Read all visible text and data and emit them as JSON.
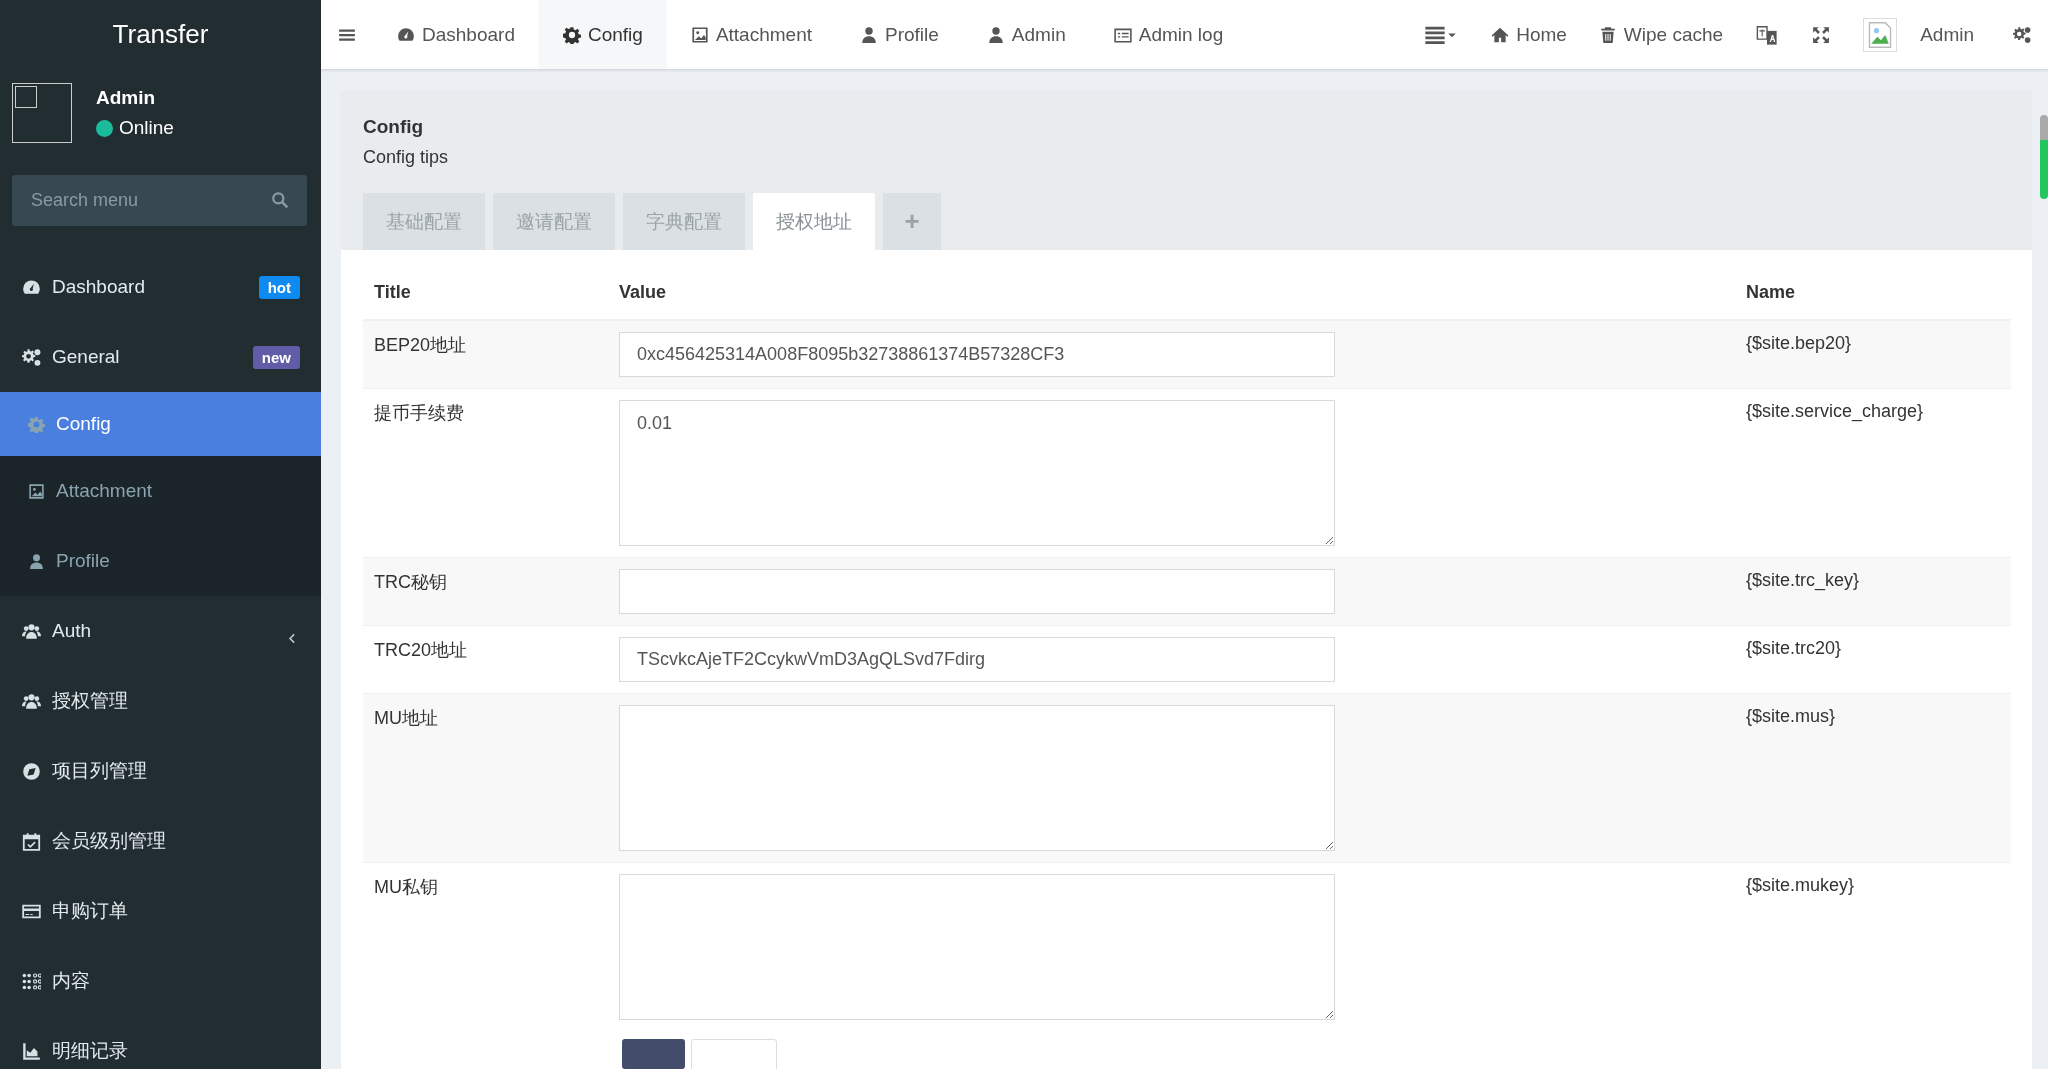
{
  "sidebar": {
    "title": "Transfer",
    "user": {
      "name": "Admin",
      "status": "Online"
    },
    "search": {
      "placeholder": "Search menu"
    },
    "items": [
      {
        "label": "Dashboard",
        "badge": "hot",
        "color": "#0f8af0",
        "selected": false
      },
      {
        "label": "General",
        "badge": "new",
        "color": "#605ca8",
        "selected": false,
        "expanded": true,
        "children": [
          {
            "label": "Config",
            "selected": true
          },
          {
            "label": "Attachment",
            "selected": false
          },
          {
            "label": "Profile",
            "selected": false
          }
        ]
      },
      {
        "label": "Auth",
        "selected": false,
        "expanded": false
      },
      {
        "label": "授权管理",
        "selected": false
      },
      {
        "label": "项目列管理",
        "selected": false
      },
      {
        "label": "会员级别管理",
        "selected": false
      },
      {
        "label": "申购订单",
        "selected": false
      },
      {
        "label": "内容",
        "selected": false
      },
      {
        "label": "明细记录",
        "selected": false
      }
    ]
  },
  "navbar": {
    "tabs": [
      {
        "label": "Dashboard",
        "selected": false
      },
      {
        "label": "Config",
        "selected": true
      },
      {
        "label": "Attachment",
        "selected": false
      },
      {
        "label": "Profile",
        "selected": false
      },
      {
        "label": "Admin",
        "selected": false
      },
      {
        "label": "Admin log",
        "selected": false
      }
    ],
    "links": [
      {
        "label": "Home"
      },
      {
        "label": "Wipe cache"
      }
    ],
    "user": "Admin"
  },
  "panel": {
    "title": "Config",
    "tips": "Config tips",
    "tabs": [
      {
        "label": "基础配置",
        "selected": false
      },
      {
        "label": "邀请配置",
        "selected": false
      },
      {
        "label": "字典配置",
        "selected": false
      },
      {
        "label": "授权地址",
        "selected": true
      },
      {
        "label": "+",
        "selected": false
      }
    ],
    "table": {
      "columns": [
        "Title",
        "Value",
        "Name"
      ],
      "rows": [
        {
          "title": "BEP20地址",
          "kind": "input",
          "value": "0xc456425314A008F8095b32738861374B57328CF3",
          "name": "{$site.bep20}"
        },
        {
          "title": "提币手续费",
          "kind": "textarea",
          "value": "0.01",
          "name": "{$site.service_charge}"
        },
        {
          "title": "TRC秘钥",
          "kind": "input",
          "value": "",
          "name": "{$site.trc_key}"
        },
        {
          "title": "TRC20地址",
          "kind": "input",
          "value": "TScvkcAjeTF2CcykwVmD3AgQLSvd7Fdirg",
          "name": "{$site.trc20}"
        },
        {
          "title": "MU地址",
          "kind": "textarea",
          "value": "",
          "name": "{$site.mus}"
        },
        {
          "title": "MU私钥",
          "kind": "textarea",
          "value": "",
          "name": "{$site.mukey}"
        }
      ]
    }
  }
}
